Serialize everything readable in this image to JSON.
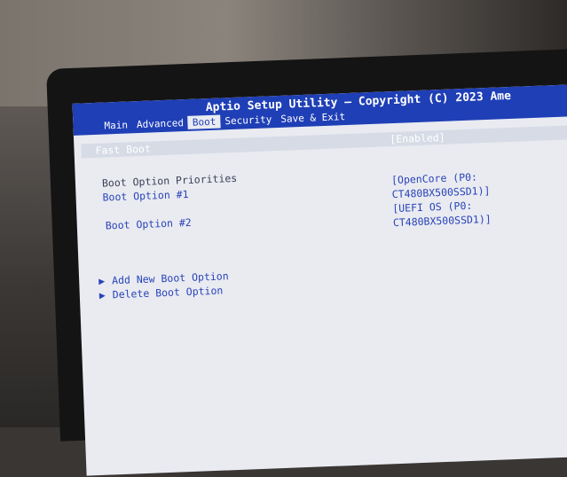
{
  "header": {
    "title": "Aptio Setup Utility – Copyright (C) 2023 Ame",
    "tabs": [
      {
        "label": "Main",
        "active": false
      },
      {
        "label": "Advanced",
        "active": false
      },
      {
        "label": "Boot",
        "active": true
      },
      {
        "label": "Security",
        "active": false
      },
      {
        "label": "Save & Exit",
        "active": false
      }
    ]
  },
  "boot": {
    "fast_boot_label": "Fast Boot",
    "fast_boot_value": "[Enabled]",
    "priorities_heading": "Boot Option Priorities",
    "option1_label": "Boot Option #1",
    "option1_value_line1": "[OpenCore (P0:",
    "option1_value_line2": "CT480BX500SSD1)]",
    "option2_label": "Boot Option #2",
    "option2_value_line1": "[UEFI OS (P0:",
    "option2_value_line2": "CT480BX500SSD1)]",
    "add_new_label": "Add New Boot Option",
    "delete_label": "Delete Boot Option"
  },
  "icons": {
    "submenu_arrow": "▶"
  },
  "colors": {
    "header_blue": "#1f3fb6",
    "screen_bg": "#e9ebf1",
    "text_blue": "#2a43b8"
  }
}
